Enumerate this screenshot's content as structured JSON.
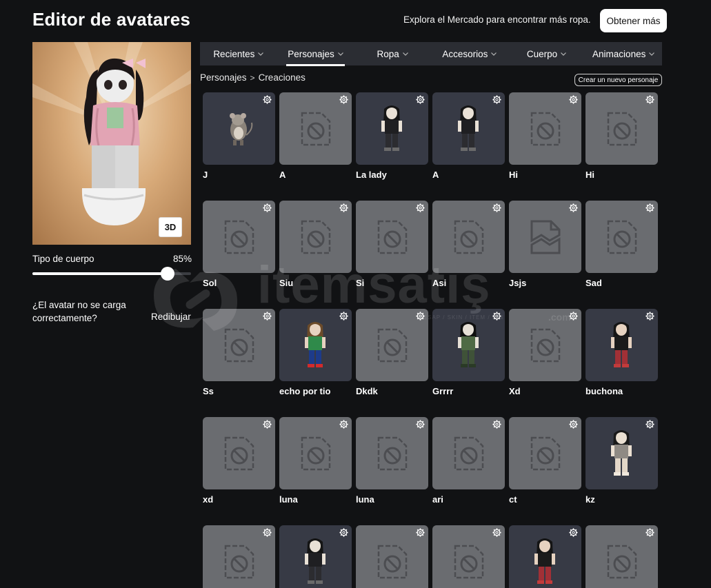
{
  "header": {
    "title": "Editor de avatares",
    "market_text": "Explora el Mercado para encontrar más ropa.",
    "get_more_label": "Obtener más"
  },
  "preview": {
    "view_toggle_label": "3D",
    "body_type_label": "Tipo de cuerpo",
    "body_type_value": "85%",
    "body_type_fraction": 0.85,
    "reload_question": "¿El avatar no se carga correctamente?",
    "redraw_label": "Redibujar"
  },
  "tabs": [
    {
      "label": "Recientes",
      "active": false
    },
    {
      "label": "Personajes",
      "active": true
    },
    {
      "label": "Ropa",
      "active": false
    },
    {
      "label": "Accesorios",
      "active": false
    },
    {
      "label": "Cuerpo",
      "active": false
    },
    {
      "label": "Animaciones",
      "active": false
    }
  ],
  "breadcrumb": {
    "parent": "Personajes",
    "separator": ">",
    "current": "Creaciones"
  },
  "create_button_label": "Crear un nuevo personaje",
  "watermark": {
    "brand": "itemsatış",
    "tagline": "HESAP / SKIN / ITEM / PIN",
    "suffix": ".com"
  },
  "characters": [
    {
      "name": "J",
      "thumb": "rat"
    },
    {
      "name": "A",
      "thumb": "blocked"
    },
    {
      "name": "La lady",
      "thumb": "avatar-dark"
    },
    {
      "name": "A",
      "thumb": "avatar-dark"
    },
    {
      "name": "Hi",
      "thumb": "blocked"
    },
    {
      "name": "Hi",
      "thumb": "blocked"
    },
    {
      "name": "Sol",
      "thumb": "blocked"
    },
    {
      "name": "Siu",
      "thumb": "blocked"
    },
    {
      "name": "Si",
      "thumb": "blocked"
    },
    {
      "name": "Asi",
      "thumb": "blocked"
    },
    {
      "name": "Jsjs",
      "thumb": "broken"
    },
    {
      "name": "Sad",
      "thumb": "blocked"
    },
    {
      "name": "Ss",
      "thumb": "blocked"
    },
    {
      "name": "echo por tio",
      "thumb": "avatar-colorful"
    },
    {
      "name": "Dkdk",
      "thumb": "blocked"
    },
    {
      "name": "Grrrr",
      "thumb": "avatar-green"
    },
    {
      "name": "Xd",
      "thumb": "blocked"
    },
    {
      "name": "buchona",
      "thumb": "avatar-red"
    },
    {
      "name": "xd",
      "thumb": "blocked"
    },
    {
      "name": "luna",
      "thumb": "blocked"
    },
    {
      "name": "luna",
      "thumb": "blocked"
    },
    {
      "name": "ari",
      "thumb": "blocked"
    },
    {
      "name": "ct",
      "thumb": "blocked"
    },
    {
      "name": "kz",
      "thumb": "avatar-light"
    },
    {
      "name": "",
      "thumb": "blocked"
    },
    {
      "name": "",
      "thumb": "avatar-dark"
    },
    {
      "name": "",
      "thumb": "blocked"
    },
    {
      "name": "",
      "thumb": "blocked"
    },
    {
      "name": "",
      "thumb": "avatar-red"
    },
    {
      "name": "",
      "thumb": "blocked"
    }
  ]
}
